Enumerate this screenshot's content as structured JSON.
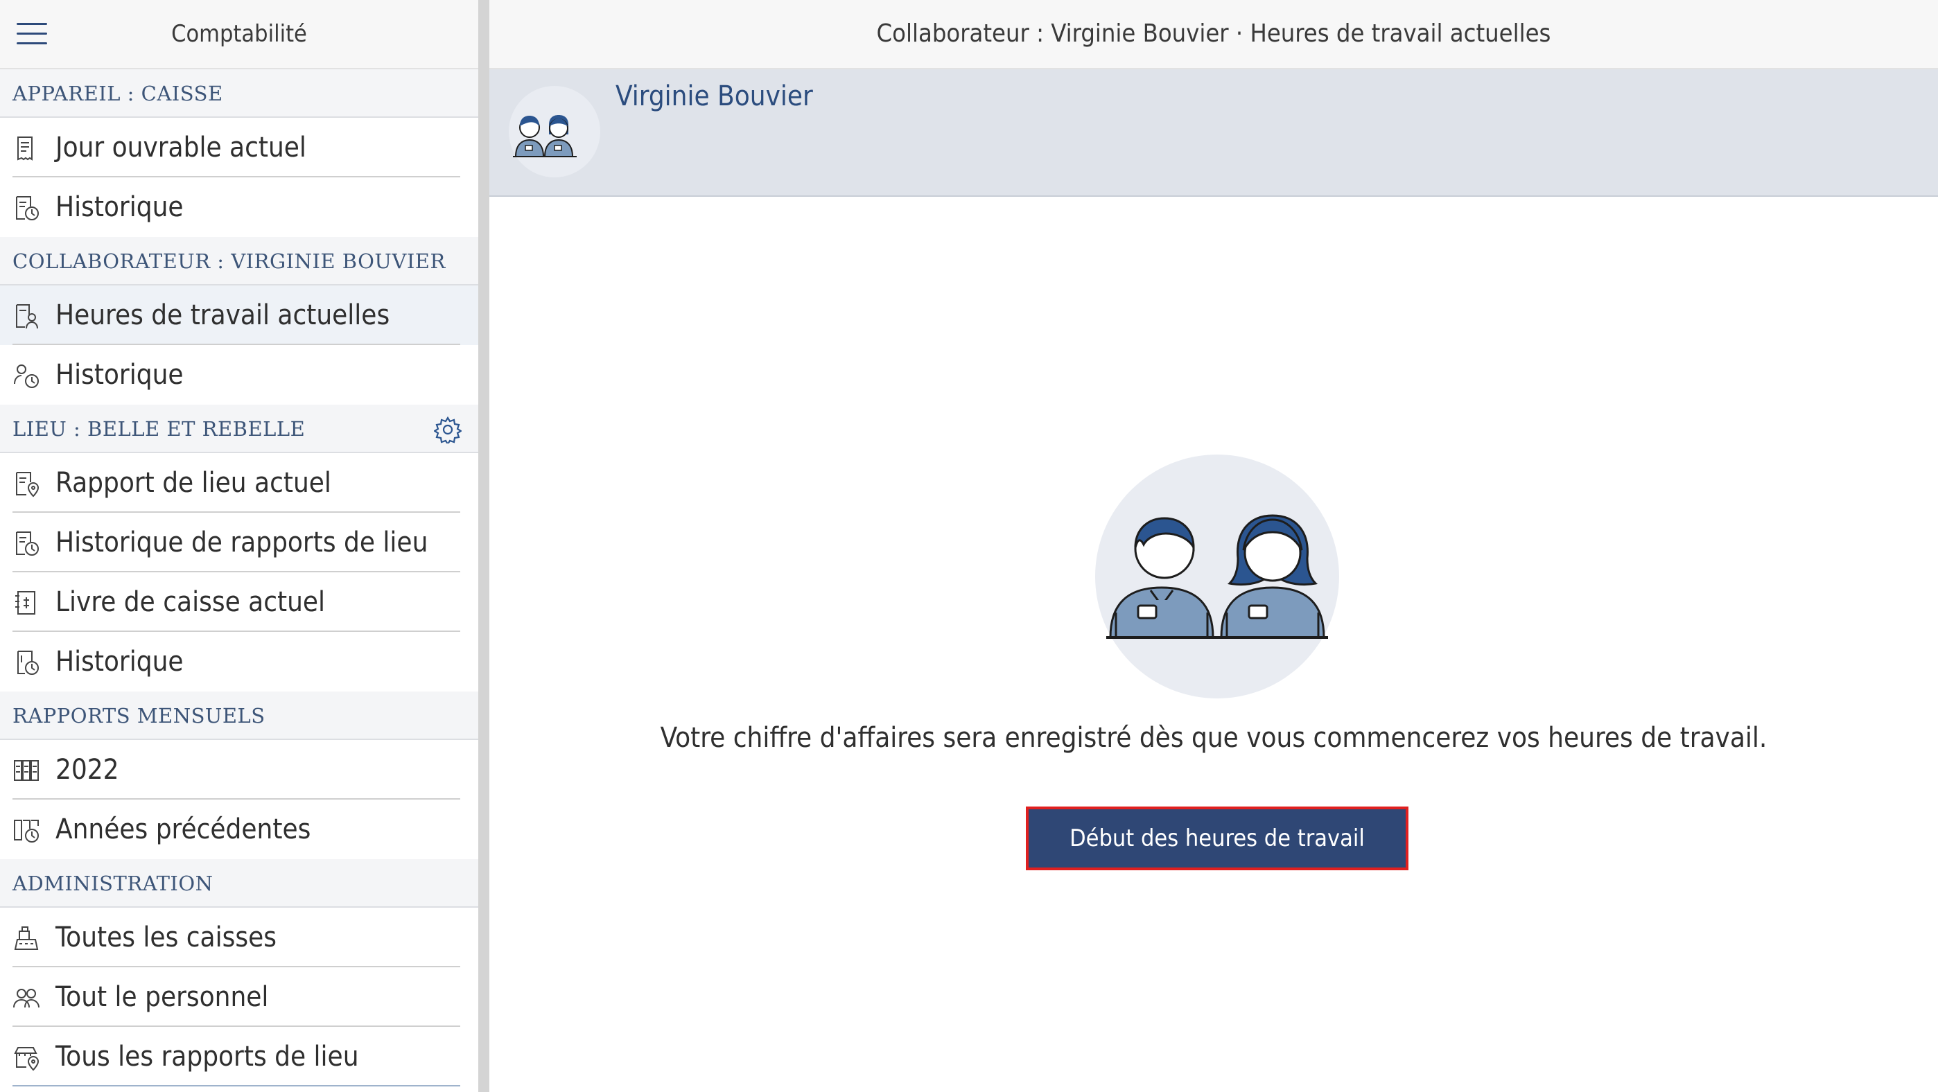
{
  "sidebar": {
    "title": "Comptabilité",
    "sections": [
      {
        "label": "APPAREIL : CAISSE"
      },
      {
        "label": "COLLABORATEUR : VIRGINIE BOUVIER"
      },
      {
        "label": "LIEU : BELLE ET REBELLE"
      },
      {
        "label": "RAPPORTS MENSUELS"
      },
      {
        "label": "ADMINISTRATION"
      }
    ],
    "items": [
      {
        "label": "Jour ouvrable actuel",
        "icon": "receipt-icon"
      },
      {
        "label": "Historique",
        "icon": "receipt-history-icon"
      },
      {
        "label": "Heures de travail actuelles",
        "icon": "receipt-person-icon",
        "active": true
      },
      {
        "label": "Historique",
        "icon": "person-clock-icon"
      },
      {
        "label": "Rapport de lieu actuel",
        "icon": "receipt-location-icon"
      },
      {
        "label": "Historique de rapports de lieu",
        "icon": "receipt-history-icon"
      },
      {
        "label": "Livre de caisse actuel",
        "icon": "cash-book-icon"
      },
      {
        "label": "Historique",
        "icon": "cash-book-history-icon"
      },
      {
        "label": "2022",
        "icon": "calendar-grid-icon"
      },
      {
        "label": "Années précédentes",
        "icon": "calendar-history-icon"
      },
      {
        "label": "Toutes les caisses",
        "icon": "cash-register-icon"
      },
      {
        "label": "Tout le personnel",
        "icon": "people-icon"
      },
      {
        "label": "Tous les rapports de lieu",
        "icon": "store-location-icon"
      }
    ]
  },
  "header": {
    "title": "Collaborateur : Virginie Bouvier · Heures de travail actuelles"
  },
  "profile": {
    "name": "Virginie Bouvier"
  },
  "main": {
    "message": "Votre chiffre d'affaires sera enregistré dès que vous commencerez vos heures de travail.",
    "start_button": "Début des heures de travail"
  },
  "colors": {
    "accent": "#2f4775",
    "highlight_border": "#e02020",
    "section_text": "#3d5578",
    "avatar_body": "#7d9bbd",
    "avatar_hair": "#2b5590"
  }
}
